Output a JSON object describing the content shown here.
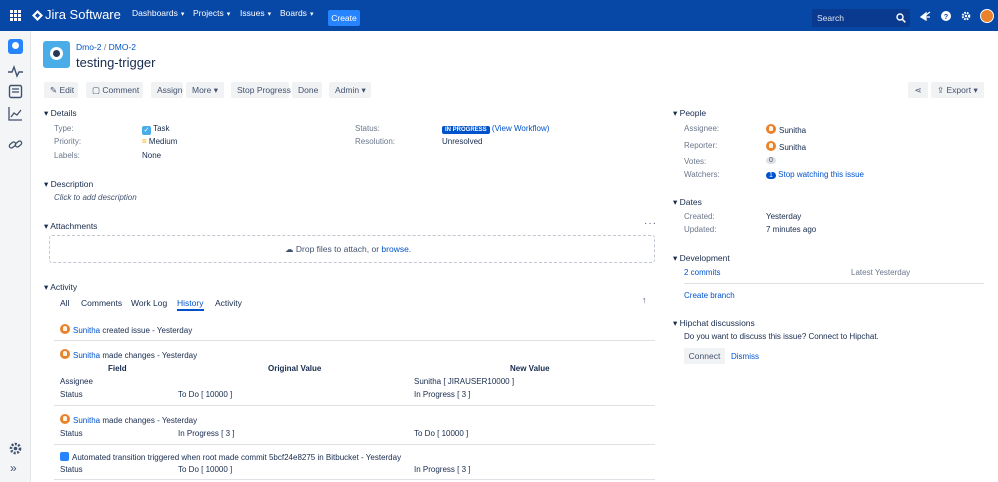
{
  "nav": {
    "logo": "Jira Software",
    "items": [
      "Dashboards",
      "Projects",
      "Issues",
      "Boards"
    ],
    "create": "Create",
    "search_placeholder": "Search"
  },
  "issue": {
    "project": "Dmo-2",
    "key": "DMO-2",
    "title": "testing-trigger"
  },
  "toolbar": {
    "edit": "Edit",
    "comment": "Comment",
    "assign": "Assign",
    "more": "More",
    "stop_progress": "Stop Progress",
    "done": "Done",
    "admin": "Admin",
    "export": "Export"
  },
  "details": {
    "heading": "Details",
    "type_label": "Type:",
    "type_value": "Task",
    "priority_label": "Priority:",
    "priority_value": "Medium",
    "labels_label": "Labels:",
    "labels_value": "None",
    "status_label": "Status:",
    "status_badge": "IN PROGRESS",
    "view_workflow": "(View Workflow)",
    "resolution_label": "Resolution:",
    "resolution_value": "Unresolved"
  },
  "description": {
    "heading": "Description",
    "placeholder": "Click to add description"
  },
  "attachments": {
    "heading": "Attachments",
    "drop_text": "Drop files to attach, or",
    "browse": "browse."
  },
  "activity": {
    "heading": "Activity",
    "tabs": [
      "All",
      "Comments",
      "Work Log",
      "History",
      "Activity"
    ],
    "active_tab": "History",
    "entries": [
      {
        "user": "Sunitha",
        "text": "created issue - Yesterday"
      },
      {
        "user": "Sunitha",
        "text": "made changes - Yesterday",
        "headers": [
          "Field",
          "Original Value",
          "New Value"
        ],
        "rows": [
          [
            "Assignee",
            "",
            "Sunitha [ JIRAUSER10000 ]"
          ],
          [
            "Status",
            "To Do [ 10000 ]",
            "In Progress [ 3 ]"
          ]
        ]
      },
      {
        "user": "Sunitha",
        "text": "made changes - Yesterday",
        "rows": [
          [
            "Status",
            "In Progress [ 3 ]",
            "To Do [ 10000 ]"
          ]
        ]
      },
      {
        "user": "",
        "text": "Automated transition triggered when root made commit 5bcf24e8275 in Bitbucket - Yesterday",
        "rows": [
          [
            "Status",
            "To Do [ 10000 ]",
            "In Progress [ 3 ]"
          ]
        ]
      }
    ]
  },
  "people": {
    "heading": "People",
    "assignee_label": "Assignee:",
    "assignee": "Sunitha",
    "reporter_label": "Reporter:",
    "reporter": "Sunitha",
    "votes_label": "Votes:",
    "votes": "0",
    "watchers_label": "Watchers:",
    "watchers": "1",
    "stop_watching": "Stop watching this issue"
  },
  "dates": {
    "heading": "Dates",
    "created_label": "Created:",
    "created": "Yesterday",
    "updated_label": "Updated:",
    "updated": "7 minutes ago"
  },
  "development": {
    "heading": "Development",
    "commits": "2 commits",
    "latest": "Latest Yesterday",
    "create_branch": "Create branch"
  },
  "hipchat": {
    "heading": "Hipchat discussions",
    "prompt": "Do you want to discuss this issue? Connect to Hipchat.",
    "connect": "Connect",
    "dismiss": "Dismiss"
  },
  "colors": {
    "nav_bg": "#0747a6",
    "accent": "#0052cc",
    "status_badge": "#0052cc",
    "avatar": "#e9822b"
  }
}
